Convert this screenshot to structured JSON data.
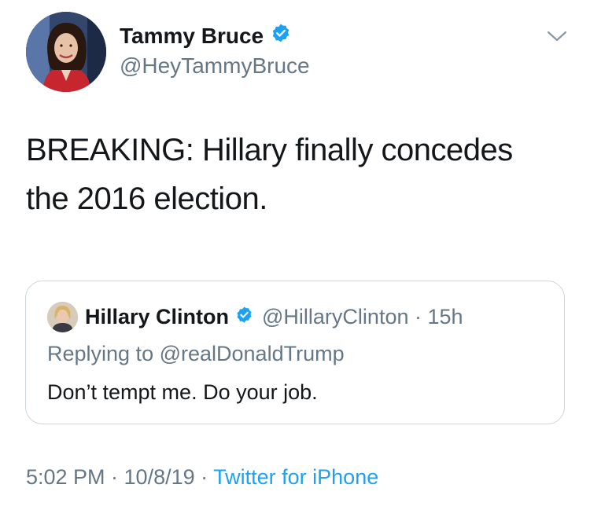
{
  "tweet": {
    "author_name": "Tammy Bruce",
    "author_handle": "@HeyTammyBruce",
    "text_line1": "BREAKING: Hillary finally concedes",
    "text_line2": "the 2016 election.",
    "timestamp": "5:02 PM · 10/8/19 · ",
    "source": "Twitter for iPhone"
  },
  "quoted_tweet": {
    "author_name": "Hillary Clinton",
    "author_handle": "@HillaryClinton · 15h",
    "replying_prefix": "Replying to ",
    "replying_to": "@realDonaldTrump",
    "text": "Don’t tempt me. Do your job."
  },
  "icons": {
    "verified": "verified-badge-icon",
    "caret": "chevron-down-icon"
  },
  "colors": {
    "text": "#14171a",
    "secondary": "#657786",
    "link": "#1da1f2",
    "verified": "#1da1f2",
    "border": "#ccd6dd"
  }
}
